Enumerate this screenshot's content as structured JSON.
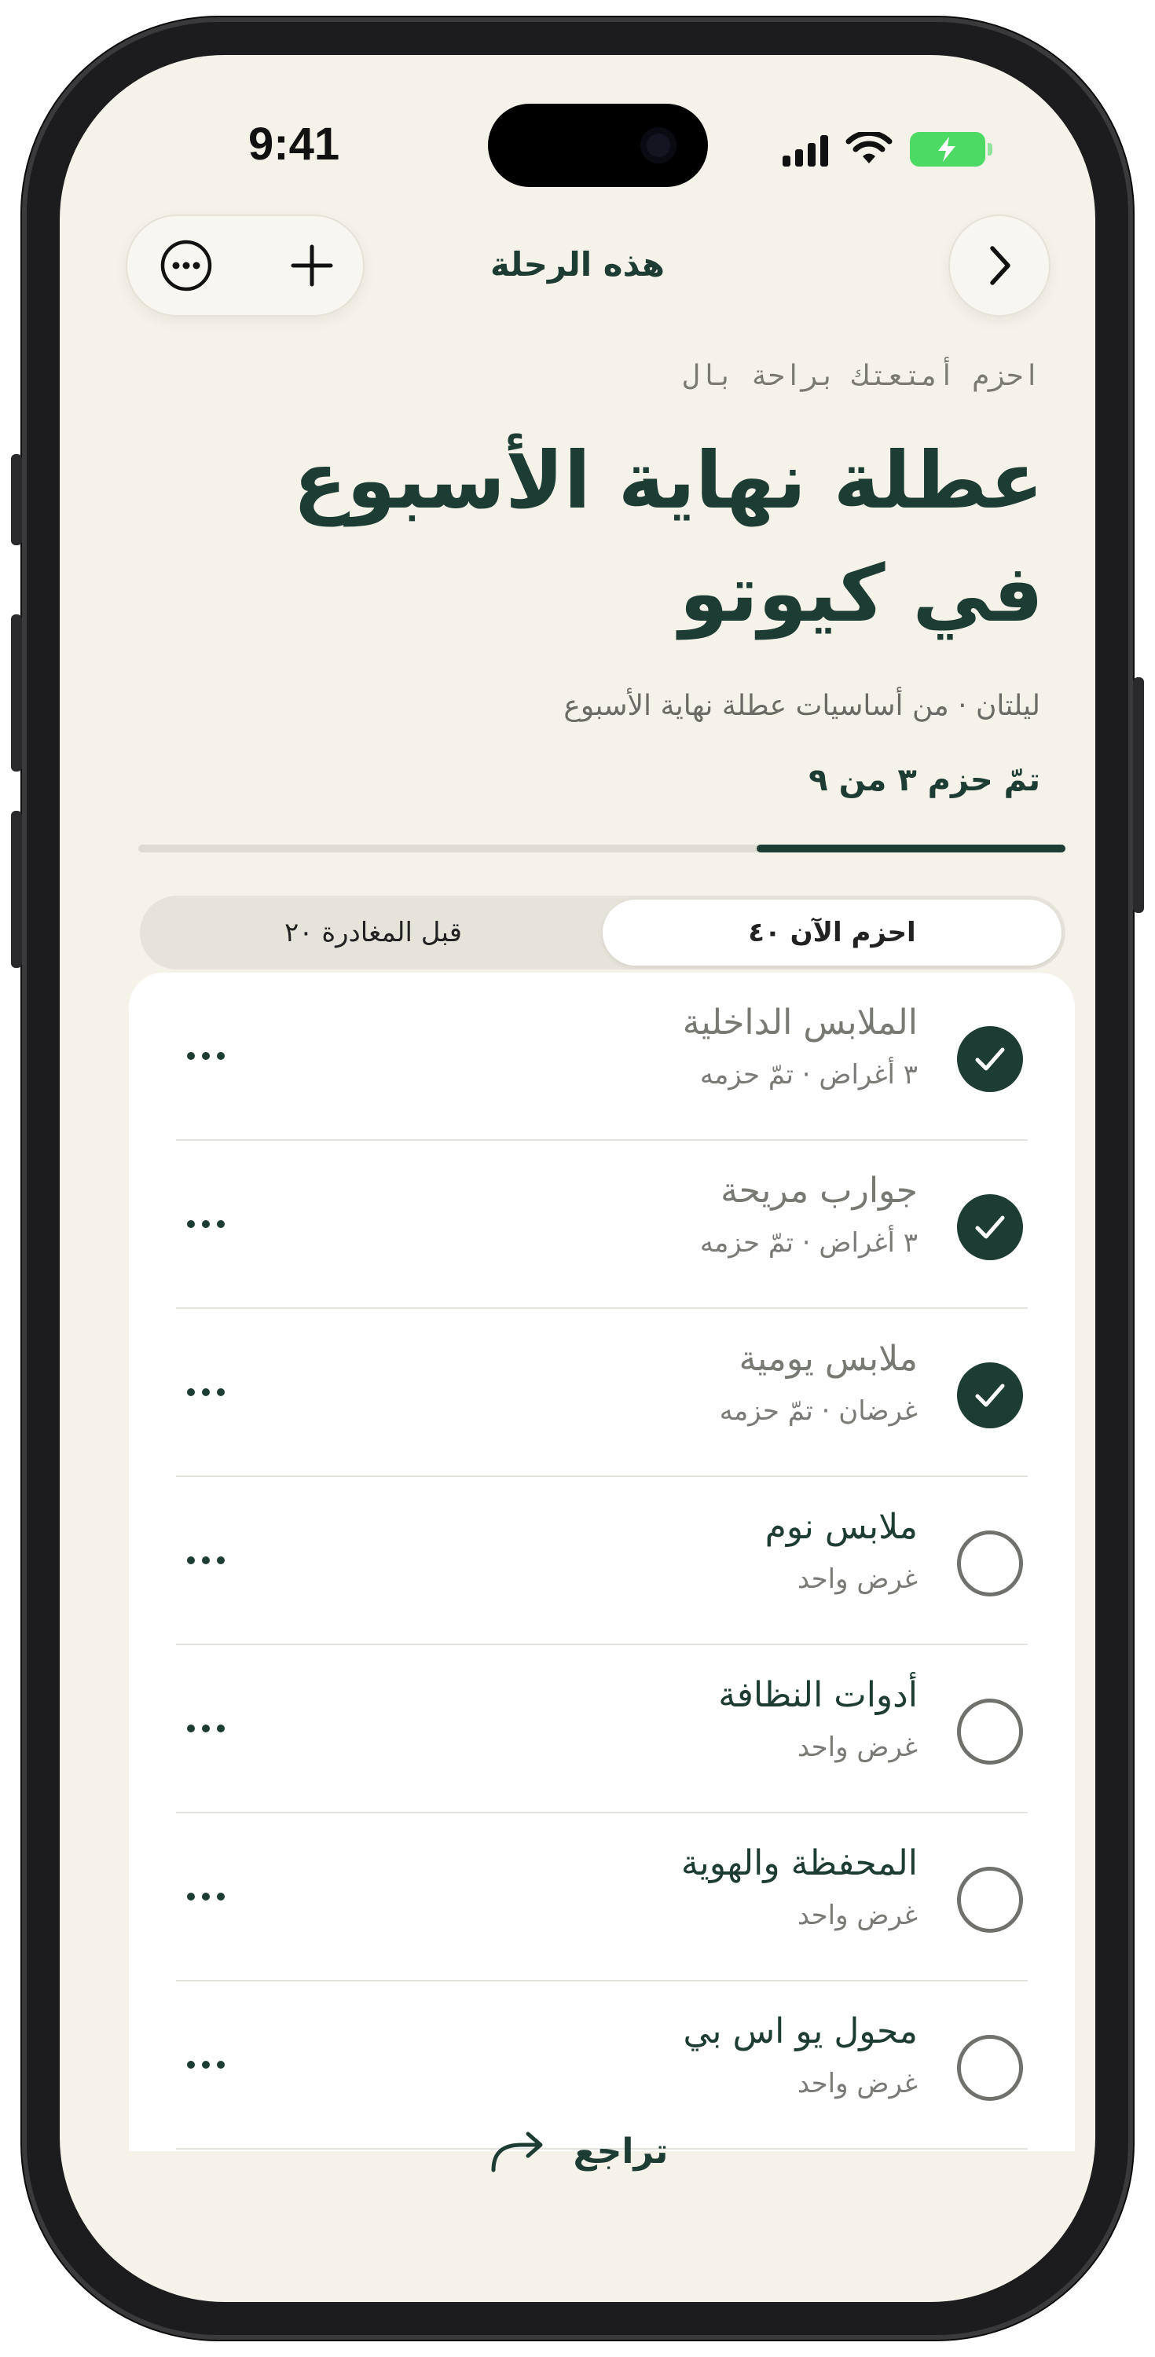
{
  "status_bar": {
    "time": "9:41",
    "icons": [
      "cellular-signal-icon",
      "wifi-icon",
      "battery-charging-icon"
    ]
  },
  "nav": {
    "title": "هذه الرحلة",
    "more_icon": "ellipsis-circle-icon",
    "add_icon": "plus-icon",
    "back_icon": "chevron-right-icon"
  },
  "header": {
    "eyebrow": "احزم أمتعتك براحة بال",
    "title": "عطلة نهاية الأسبوع في كيوتو",
    "subtitle": "ليلتان · من أساسيات عطلة نهاية الأسبوع",
    "progress_label": "تمّ حزم ٣ من ٩",
    "progress_packed": 3,
    "progress_total": 9
  },
  "tabs": [
    {
      "label": "احزم الآن ٤٠",
      "active": true
    },
    {
      "label": "قبل المغادرة ٢٠",
      "active": false
    }
  ],
  "items": [
    {
      "name": "الملابس الداخلية",
      "meta": "٣ أغراض · تمّ حزمه",
      "packed": true
    },
    {
      "name": "جوارب مريحة",
      "meta": "٣ أغراض · تمّ حزمه",
      "packed": true
    },
    {
      "name": "ملابس يومية",
      "meta": "غرضان · تمّ حزمه",
      "packed": true
    },
    {
      "name": "ملابس نوم",
      "meta": "غرض واحد",
      "packed": false
    },
    {
      "name": "أدوات النظافة",
      "meta": "غرض واحد",
      "packed": false
    },
    {
      "name": "المحفظة والهوية",
      "meta": "غرض واحد",
      "packed": false
    },
    {
      "name": "محول يو اس بي",
      "meta": "غرض واحد",
      "packed": false
    }
  ],
  "footer": {
    "action_label": "تراجع",
    "action_icon": "redo-arrow-icon"
  },
  "colors": {
    "accent": "#1d3c34",
    "background": "#f5f2ea",
    "battery": "#4cd964"
  }
}
